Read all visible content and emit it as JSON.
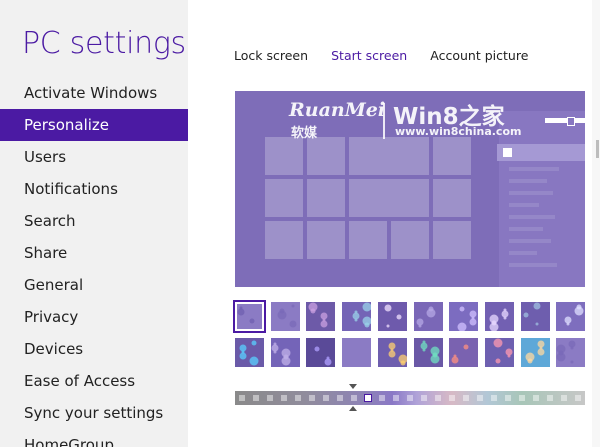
{
  "app": {
    "title": "PC settings"
  },
  "sidebar": {
    "items": [
      {
        "label": "Activate Windows",
        "selected": false
      },
      {
        "label": "Personalize",
        "selected": true
      },
      {
        "label": "Users",
        "selected": false
      },
      {
        "label": "Notifications",
        "selected": false
      },
      {
        "label": "Search",
        "selected": false
      },
      {
        "label": "Share",
        "selected": false
      },
      {
        "label": "General",
        "selected": false
      },
      {
        "label": "Privacy",
        "selected": false
      },
      {
        "label": "Devices",
        "selected": false
      },
      {
        "label": "Ease of Access",
        "selected": false
      },
      {
        "label": "Sync your settings",
        "selected": false
      },
      {
        "label": "HomeGroup",
        "selected": false
      }
    ]
  },
  "tabs": [
    {
      "label": "Lock screen",
      "active": false
    },
    {
      "label": "Start screen",
      "active": true
    },
    {
      "label": "Account picture",
      "active": false
    }
  ],
  "watermark": {
    "logo": "RuanMei",
    "chinese": "软媒",
    "brand": "Win8之家",
    "url": "www.win8china.com"
  },
  "patterns": {
    "selected_index": 0,
    "items": [
      "pattern-blank-icon",
      "pattern-plain-icon",
      "pattern-swirl-icon",
      "pattern-birds-icon",
      "pattern-flowers-icon",
      "pattern-leaves-icon",
      "pattern-twigs-icon",
      "pattern-feathers-icon",
      "pattern-ferns-icon",
      "pattern-circles-icon",
      "pattern-dots-icon",
      "pattern-waves-icon",
      "pattern-ribbon-icon",
      "pattern-plain2-icon",
      "pattern-guitar-icon",
      "pattern-bubbles-icon",
      "pattern-splash-icon",
      "pattern-petals-icon",
      "pattern-coral-icon",
      "pattern-shapes-icon"
    ]
  },
  "color_strip": {
    "swatch_count": 25,
    "selected_index": 9
  },
  "colors": {
    "accent": "#4b1aa3",
    "background": "#7e6db8",
    "tile": "#9d91c9"
  }
}
